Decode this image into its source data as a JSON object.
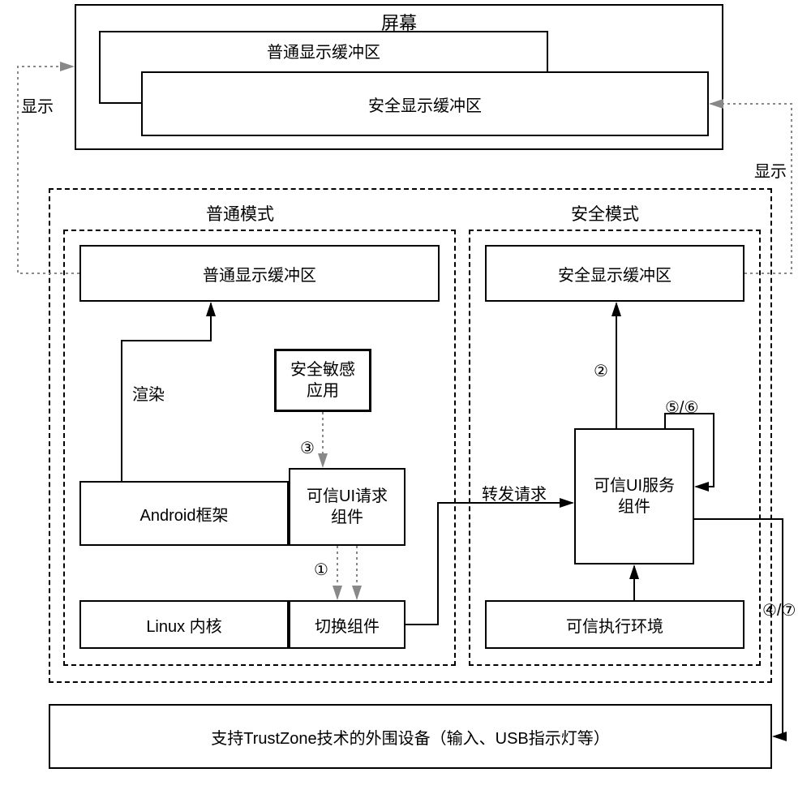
{
  "screen": {
    "title": "屏幕",
    "normal_buffer": "普通显示缓冲区",
    "secure_buffer": "安全显示缓冲区"
  },
  "display_left": "显示",
  "display_right": "显示",
  "normal_mode": {
    "title": "普通模式",
    "buffer": "普通显示缓冲区",
    "render": "渲染",
    "app": "安全敏感应用",
    "android": "Android框架",
    "trusted_ui_req": "可信UI请求组件",
    "linux": "Linux 内核",
    "switch": "切换组件",
    "step1": "①",
    "step3": "③"
  },
  "secure_mode": {
    "title": "安全模式",
    "buffer": "安全显示缓冲区",
    "step2": "②",
    "step56": "⑤/⑥",
    "forward": "转发请求",
    "trusted_ui_svc": "可信UI服务组件",
    "tee": "可信执行环境",
    "step47": "④/⑦"
  },
  "peripheral": "支持TrustZone技术的外围设备（输入、USB指示灯等）"
}
